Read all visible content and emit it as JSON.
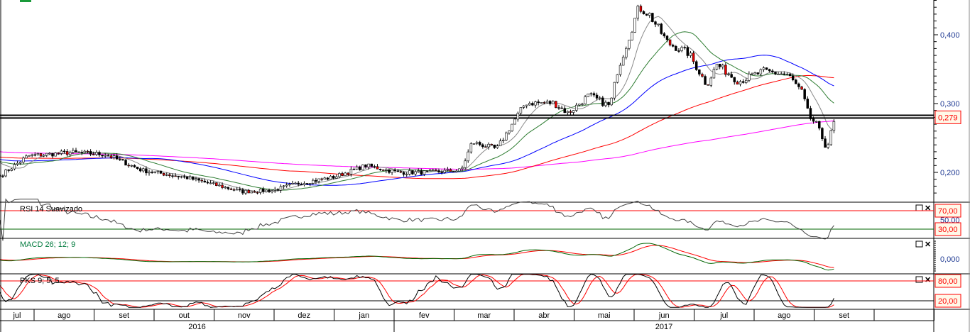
{
  "chart_data": {
    "type": "candlestick",
    "title": "",
    "colors": {
      "support": "#000000",
      "price_tag": "#ff0000",
      "axis_text": "#1f3a93",
      "rsi_hi": "#ff0000",
      "rsi_lo": "#006400",
      "macd": "#006400",
      "signal": "#ff0000",
      "pks_k": "#000000",
      "pks_d": "#ff0000",
      "ma9": "#888888",
      "ma21": "#2e7d32",
      "ma50": "#0000ff",
      "ma100": "#ff0000",
      "ma200": "#ff00ff"
    },
    "time_unit": "months since 2016-07-01",
    "price_points": [
      [
        0.43,
        0.195
      ],
      [
        0.9,
        0.224
      ],
      [
        1.61,
        0.229
      ],
      [
        2.2,
        0.226
      ],
      [
        2.8,
        0.203
      ],
      [
        3.51,
        0.193
      ],
      [
        4.1,
        0.18
      ],
      [
        4.46,
        0.172
      ],
      [
        4.98,
        0.174
      ],
      [
        5.4,
        0.184
      ],
      [
        5.99,
        0.193
      ],
      [
        6.53,
        0.21
      ],
      [
        7.06,
        0.2
      ],
      [
        7.53,
        0.2
      ],
      [
        8.12,
        0.203
      ],
      [
        8.3,
        0.244
      ],
      [
        8.71,
        0.234
      ],
      [
        9.0,
        0.275
      ],
      [
        9.19,
        0.301
      ],
      [
        9.66,
        0.301
      ],
      [
        9.9,
        0.286
      ],
      [
        10.25,
        0.312
      ],
      [
        10.6,
        0.296
      ],
      [
        10.72,
        0.347
      ],
      [
        10.96,
        0.409
      ],
      [
        11.08,
        0.44
      ],
      [
        11.25,
        0.43
      ],
      [
        11.56,
        0.388
      ],
      [
        11.91,
        0.373
      ],
      [
        12.21,
        0.327
      ],
      [
        12.38,
        0.357
      ],
      [
        12.74,
        0.332
      ],
      [
        13.15,
        0.347
      ],
      [
        13.56,
        0.342
      ],
      [
        13.8,
        0.316
      ],
      [
        13.92,
        0.28
      ],
      [
        14.04,
        0.27
      ],
      [
        14.21,
        0.234
      ],
      [
        14.33,
        0.274
      ]
    ],
    "y_axis": {
      "ticks": [
        "0,200",
        "0,300",
        "0,400"
      ],
      "tick_values": [
        0.2,
        0.3,
        0.4
      ],
      "ylim": [
        0.165,
        0.455
      ]
    },
    "last_price_label": "0,279",
    "support_lines": [
      0.279,
      0.283
    ],
    "months": [
      {
        "label": "jul",
        "start": 0
      },
      {
        "label": "ago",
        "start": 1
      },
      {
        "label": "set",
        "start": 2
      },
      {
        "label": "out",
        "start": 3
      },
      {
        "label": "nov",
        "start": 4
      },
      {
        "label": "dez",
        "start": 5
      },
      {
        "label": "jan",
        "start": 6
      },
      {
        "label": "fev",
        "start": 7
      },
      {
        "label": "mar",
        "start": 8
      },
      {
        "label": "abr",
        "start": 9
      },
      {
        "label": "mai",
        "start": 10
      },
      {
        "label": "jun",
        "start": 11
      },
      {
        "label": "jul",
        "start": 12
      },
      {
        "label": "ago",
        "start": 13
      },
      {
        "label": "set",
        "start": 14
      }
    ],
    "years": [
      {
        "label": "2016",
        "start": 0
      },
      {
        "label": "2017",
        "start": 6
      }
    ],
    "moving_averages": [
      9,
      21,
      50,
      100,
      200
    ],
    "indicators": {
      "rsi": {
        "title": "RSI 14 Suavizado",
        "levels": [
          "70,00",
          "30,00"
        ],
        "mid_label": "50,00",
        "level_values": [
          70,
          30
        ]
      },
      "macd": {
        "title": "MACD 26; 12; 9",
        "zero_label": "0,000"
      },
      "pks": {
        "title": "PKS 9; 5; 5",
        "levels": [
          "80,00",
          "20,00"
        ],
        "level_values": [
          80,
          20
        ]
      }
    }
  }
}
